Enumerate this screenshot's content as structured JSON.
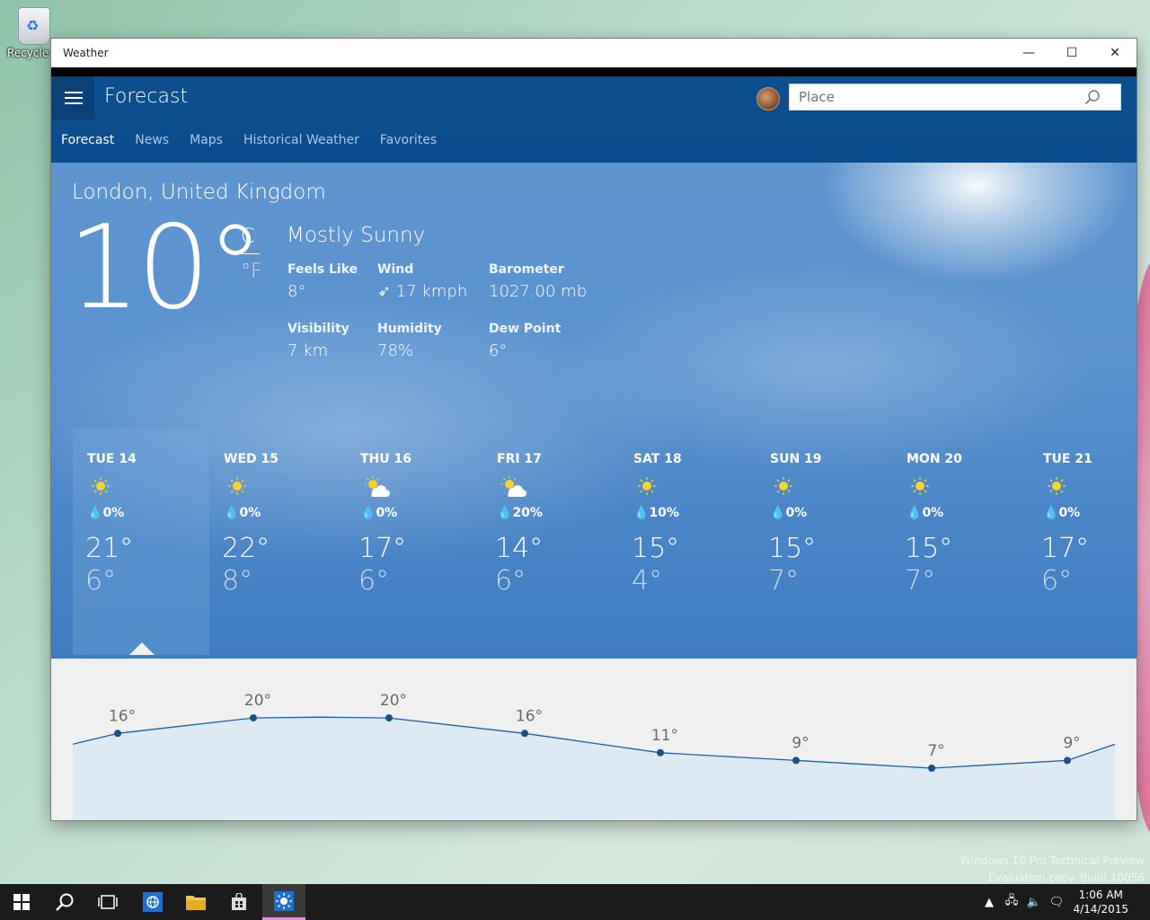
{
  "desktop": {
    "recycle_bin_label": "Recycle Bin",
    "watermark_line1": "Windows 10 Pro Technical Preview",
    "watermark_line2": "Evaluation copy. Build 10056"
  },
  "window": {
    "title": "Weather",
    "minimize_glyph": "—",
    "maximize_glyph": "☐",
    "close_glyph": "✕"
  },
  "app": {
    "title": "Forecast",
    "search_placeholder": "Place",
    "tabs": [
      {
        "label": "Forecast",
        "active": true
      },
      {
        "label": "News",
        "active": false
      },
      {
        "label": "Maps",
        "active": false
      },
      {
        "label": "Historical Weather",
        "active": false
      },
      {
        "label": "Favorites",
        "active": false
      }
    ]
  },
  "current": {
    "location": "London, United Kingdom",
    "temp": "10°",
    "unit_c": "C",
    "unit_f": "°F",
    "condition": "Mostly Sunny",
    "details": [
      {
        "label": "Feels Like",
        "value": "8°"
      },
      {
        "label": "Wind",
        "value": "➶ 17 kmph"
      },
      {
        "label": "Barometer",
        "value": "1027.00 mb"
      },
      {
        "label": "Visibility",
        "value": "7 km"
      },
      {
        "label": "Humidity",
        "value": "78%"
      },
      {
        "label": "Dew Point",
        "value": "6°"
      }
    ]
  },
  "forecast": [
    {
      "day": "TUE 14",
      "icon": "sun-icon",
      "rain": "0%",
      "hi": "21°",
      "lo": "6°"
    },
    {
      "day": "WED 15",
      "icon": "sun-icon",
      "rain": "0%",
      "hi": "22°",
      "lo": "8°"
    },
    {
      "day": "THU 16",
      "icon": "partly-cloudy-icon",
      "rain": "0%",
      "hi": "17°",
      "lo": "6°"
    },
    {
      "day": "FRI 17",
      "icon": "partly-cloudy-icon",
      "rain": "20%",
      "hi": "14°",
      "lo": "6°"
    },
    {
      "day": "SAT 18",
      "icon": "sun-icon",
      "rain": "10%",
      "hi": "15°",
      "lo": "4°"
    },
    {
      "day": "SUN 19",
      "icon": "sun-icon",
      "rain": "0%",
      "hi": "15°",
      "lo": "7°"
    },
    {
      "day": "MON 20",
      "icon": "sun-icon",
      "rain": "0%",
      "hi": "15°",
      "lo": "7°"
    },
    {
      "day": "TUE 21",
      "icon": "sun-icon",
      "rain": "0%",
      "hi": "17°",
      "lo": "6°"
    }
  ],
  "hourly": {
    "points": [
      {
        "label": "16°",
        "value": 16
      },
      {
        "label": "20°",
        "value": 20
      },
      {
        "label": "20°",
        "value": 20
      },
      {
        "label": "16°",
        "value": 16
      },
      {
        "label": "11°",
        "value": 11
      },
      {
        "label": "9°",
        "value": 9
      },
      {
        "label": "7°",
        "value": 7
      },
      {
        "label": "9°",
        "value": 9
      }
    ],
    "line_color": "#1f5fa8",
    "fill_color": "#dde9f3"
  },
  "taskbar": {
    "time": "1:06 AM",
    "date": "4/14/2015"
  },
  "colors": {
    "appbar": "#0b5394",
    "accent": "#0a4178"
  }
}
